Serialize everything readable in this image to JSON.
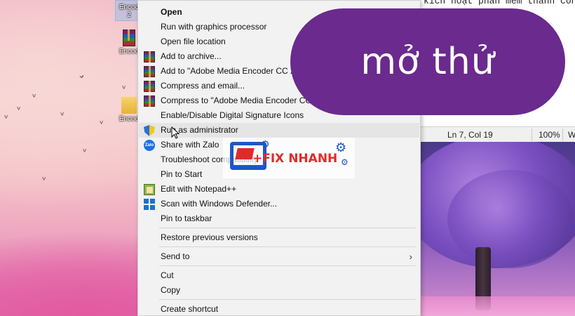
{
  "desktop": {
    "icons": [
      {
        "label": "Encod",
        "sublabel": "2",
        "type": "shortcut"
      },
      {
        "label": "Encod",
        "type": "winrar"
      },
      {
        "label": "Encod",
        "type": "folder"
      }
    ]
  },
  "editor": {
    "line_text": "kích hoạt phần mềm thành công",
    "left_text": "...",
    "status": {
      "position": "Ln 7, Col 19",
      "zoom": "100%",
      "encoding": "W"
    }
  },
  "context_menu": {
    "items": [
      {
        "label": "Open",
        "bold": true,
        "icon": "none"
      },
      {
        "label": "Run with graphics processor",
        "icon": "none"
      },
      {
        "label": "Open file location",
        "icon": "none"
      },
      {
        "label": "Add to archive...",
        "icon": "winrar-icon"
      },
      {
        "label": "Add to \"Adobe Media Encoder CC 201",
        "icon": "winrar-icon"
      },
      {
        "label": "Compress and email...",
        "icon": "winrar-icon"
      },
      {
        "label": "Compress to \"Adobe Media Encoder CC 20",
        "icon": "winrar-icon"
      },
      {
        "label": "Enable/Disable Digital Signature Icons",
        "icon": "none"
      },
      {
        "label": "Run as administrator",
        "icon": "uac-shield-icon",
        "hover": true
      },
      {
        "label": "Share with Zalo",
        "icon": "zalo-icon"
      },
      {
        "label": "Troubleshoot compatibility",
        "icon": "none"
      },
      {
        "label": "Pin to Start",
        "icon": "none"
      },
      {
        "label": "Edit with Notepad++",
        "icon": "notepad-plus-plus-icon"
      },
      {
        "label": "Scan with Windows Defender...",
        "icon": "windows-defender-icon"
      },
      {
        "label": "Pin to taskbar",
        "icon": "none"
      },
      {
        "label": "Restore previous versions",
        "icon": "none"
      },
      {
        "label": "Send to",
        "icon": "none",
        "submenu": true
      },
      {
        "label": "Cut",
        "icon": "none"
      },
      {
        "label": "Copy",
        "icon": "none"
      },
      {
        "label": "Create shortcut",
        "icon": "none"
      }
    ],
    "submenu_arrow": "›"
  },
  "overlay": {
    "caption": "mở thử",
    "color": "#6a2a8e"
  },
  "watermark": {
    "brand": "+FIX NHANH",
    "accent_red": "#e02a2a",
    "accent_blue": "#1d57c8"
  }
}
